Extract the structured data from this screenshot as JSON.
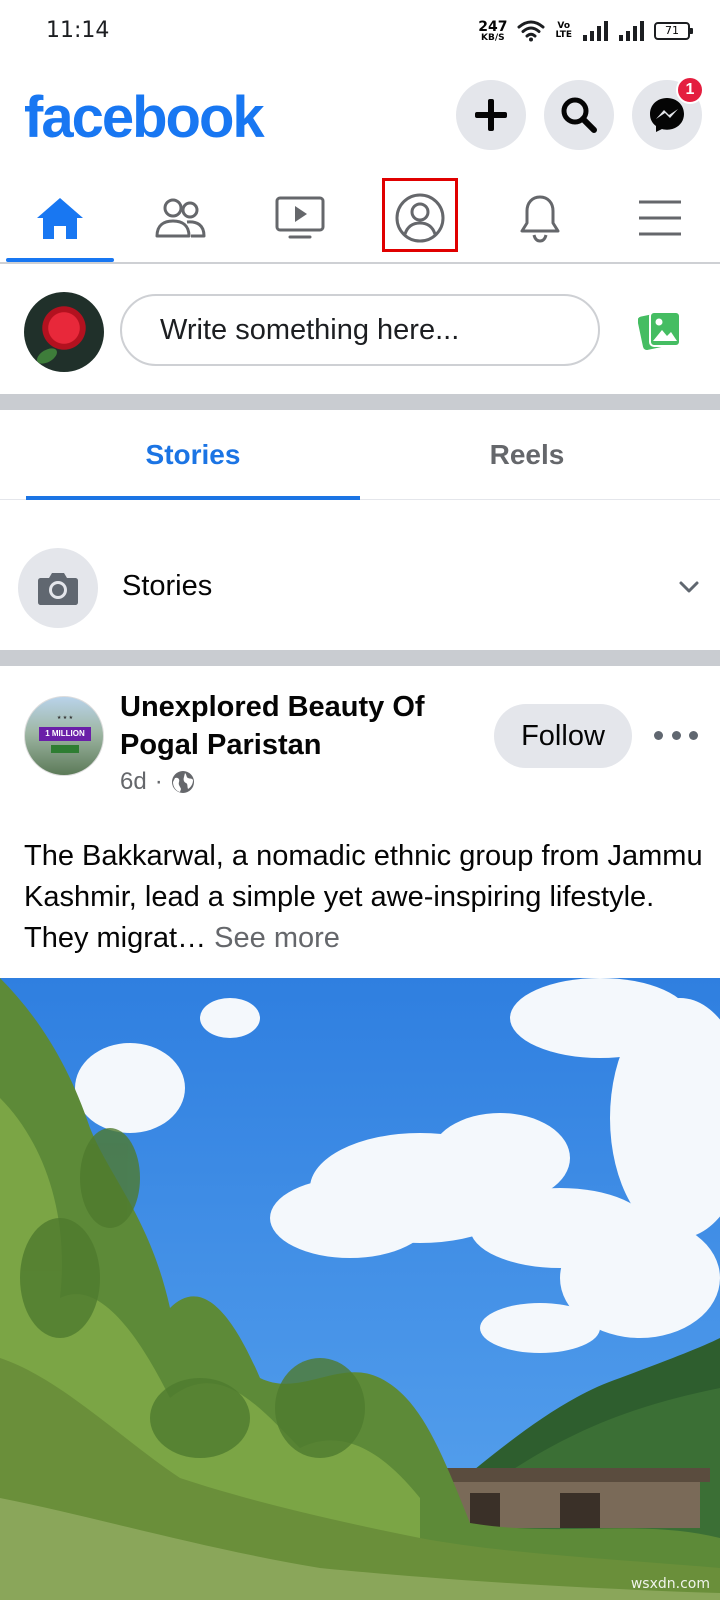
{
  "status_bar": {
    "time": "11:14",
    "net_speed_value": "247",
    "net_speed_unit": "KB/S",
    "volte_top": "Vo",
    "volte_bottom": "LTE",
    "battery": "71"
  },
  "header": {
    "logo": "facebook",
    "messenger_badge": "1"
  },
  "nav": {
    "items": [
      {
        "name": "home",
        "active": true
      },
      {
        "name": "friends",
        "active": false
      },
      {
        "name": "watch",
        "active": false
      },
      {
        "name": "profile",
        "active": false,
        "highlighted": true
      },
      {
        "name": "notifications",
        "active": false
      },
      {
        "name": "menu",
        "active": false
      }
    ]
  },
  "composer": {
    "placeholder": "Write something here..."
  },
  "story_tabs": {
    "stories": "Stories",
    "reels": "Reels",
    "active": "Stories"
  },
  "stories_row": {
    "label": "Stories"
  },
  "post": {
    "page_name": "Unexplored Beauty Of Pogal Paristan",
    "time": "6d",
    "separator": "·",
    "follow_label": "Follow",
    "avatar_badge": "1 MILLION",
    "text": "The Bakkarwal, a nomadic ethnic group from Jammu Kashmir, lead a simple yet awe-inspiring lifestyle. They migrat…",
    "see_more": "See more"
  },
  "watermark": "wsxdn.com",
  "colors": {
    "brand": "#1877f2",
    "highlight": "#e00000",
    "badge": "#e41e3f"
  }
}
